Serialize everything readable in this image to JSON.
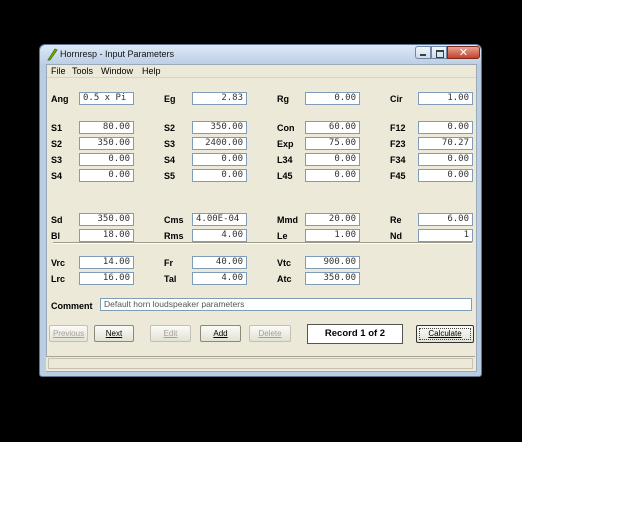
{
  "window": {
    "title": "Hornresp - Input Parameters"
  },
  "menu": {
    "file": "File",
    "tools": "Tools",
    "window": "Window",
    "help": "Help"
  },
  "params": {
    "Ang": "0.5 x Pi",
    "Eg": "2.83",
    "Rg": "0.00",
    "Cir": "1.00",
    "S1": "80.00",
    "S2a": "350.00",
    "Con": "60.00",
    "F12": "0.00",
    "S2": "350.00",
    "S3a": "2400.00",
    "Exp": "75.00",
    "F23": "70.27",
    "S3": "0.00",
    "S4a": "0.00",
    "L34": "0.00",
    "F34": "0.00",
    "S4": "0.00",
    "S5": "0.00",
    "L45": "0.00",
    "F45": "0.00",
    "Sd": "350.00",
    "Cms": "4.00E-04",
    "Mmd": "20.00",
    "Re": "6.00",
    "Bl": "18.00",
    "Rms": "4.00",
    "Le": "1.00",
    "Nd": "1",
    "Vrc": "14.00",
    "Fr": "40.00",
    "Vtc": "900.00",
    "Lrc": "16.00",
    "Tal": "4.00",
    "Atc": "350.00"
  },
  "labels": {
    "Ang": "Ang",
    "Eg": "Eg",
    "Rg": "Rg",
    "Cir": "Cir",
    "S1": "S1",
    "S2a": "S2",
    "Con": "Con",
    "F12": "F12",
    "S2": "S2",
    "S3a": "S3",
    "Exp": "Exp",
    "F23": "F23",
    "S3": "S3",
    "S4a": "S4",
    "L34": "L34",
    "F34": "F34",
    "S4": "S4",
    "S5": "S5",
    "L45": "L45",
    "F45": "F45",
    "Sd": "Sd",
    "Cms": "Cms",
    "Mmd": "Mmd",
    "Re": "Re",
    "Bl": "Bl",
    "Rms": "Rms",
    "Le": "Le",
    "Nd": "Nd",
    "Vrc": "Vrc",
    "Fr": "Fr",
    "Vtc": "Vtc",
    "Lrc": "Lrc",
    "Tal": "Tal",
    "Atc": "Atc"
  },
  "comment": {
    "label": "Comment",
    "value": "Default horn loudspeaker parameters"
  },
  "buttons": {
    "previous": "Previous",
    "next": "Next",
    "edit": "Edit",
    "add": "Add",
    "delete": "Delete",
    "calculate": "Calculate"
  },
  "record": "Record 1 of 2",
  "colors": {
    "desktop": "#000000",
    "titlebar": "#bccfe6",
    "close": "#c5422b"
  }
}
